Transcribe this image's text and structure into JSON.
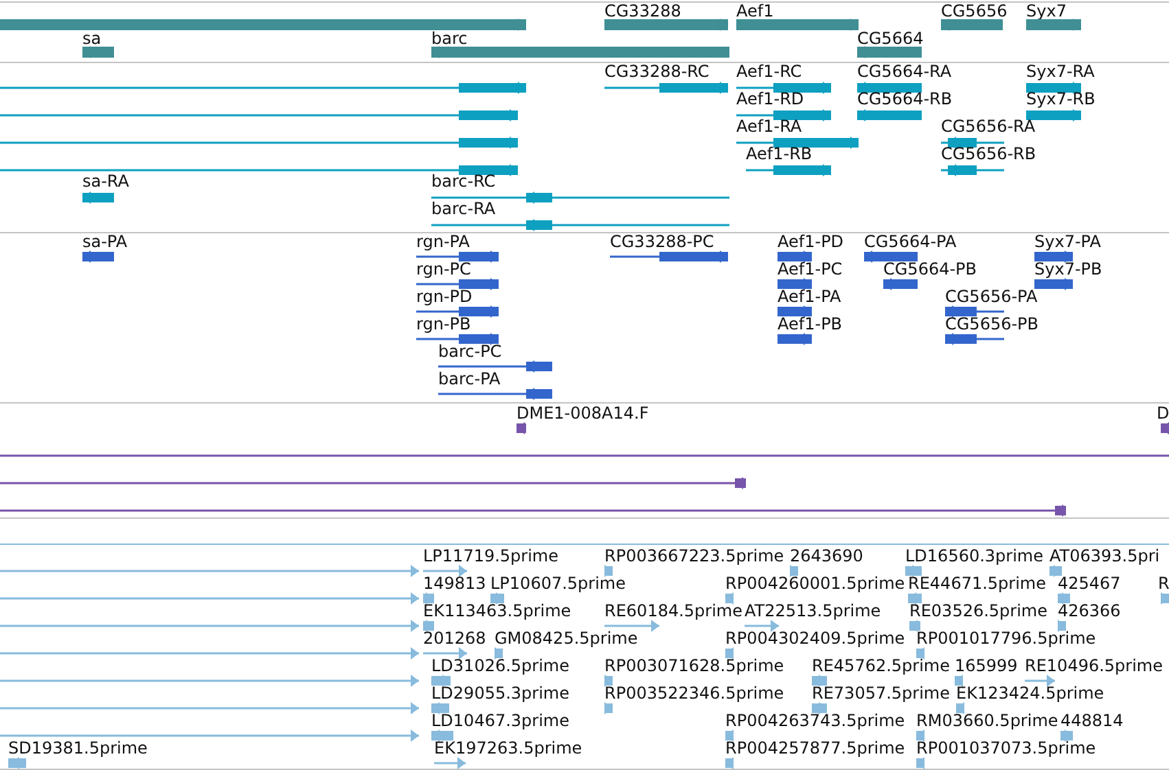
{
  "tracks": [
    {
      "kind": "gene",
      "features": [
        {
          "kind": "forward"
        },
        {
          "label": "CG33288",
          "kind": "forward"
        },
        {
          "label": "Aef1",
          "kind": "forward"
        },
        {
          "label": "CG5656",
          "kind": "reverse"
        },
        {
          "label": "Syx7",
          "kind": "forward"
        },
        {
          "label": "sa",
          "kind": "reverse"
        },
        {
          "label": "barc",
          "kind": "reverse"
        },
        {
          "label": "CG5664",
          "kind": "reverse"
        }
      ]
    },
    {
      "kind": "mrna",
      "features": [
        {
          "kind": "forward"
        },
        {
          "kind": "forward"
        },
        {
          "kind": "forward"
        },
        {
          "kind": "forward"
        },
        {
          "label": "CG33288-RC",
          "kind": "forward"
        },
        {
          "label": "Aef1-RC",
          "kind": "forward"
        },
        {
          "label": "Aef1-RD",
          "kind": "forward"
        },
        {
          "label": "Aef1-RA",
          "kind": "forward"
        },
        {
          "label": "Aef1-RB",
          "kind": "forward"
        },
        {
          "label": "CG5664-RA",
          "kind": "reverse"
        },
        {
          "label": "CG5664-RB",
          "kind": "reverse"
        },
        {
          "label": "Syx7-RA",
          "kind": "forward"
        },
        {
          "label": "Syx7-RB",
          "kind": "forward"
        },
        {
          "label": "CG5656-RA",
          "kind": "reverse"
        },
        {
          "label": "CG5656-RB",
          "kind": "reverse"
        },
        {
          "label": "sa-RA",
          "kind": "reverse"
        },
        {
          "label": "barc-RC",
          "kind": "reverse"
        },
        {
          "label": "barc-RA",
          "kind": "reverse"
        }
      ]
    },
    {
      "kind": "protein",
      "features": [
        {
          "label": "sa-PA",
          "kind": "reverse"
        },
        {
          "label": "rgn-PA",
          "kind": "forward"
        },
        {
          "label": "CG33288-PC",
          "kind": "forward"
        },
        {
          "label": "Aef1-PD",
          "kind": "forward"
        },
        {
          "label": "CG5664-PA",
          "kind": "reverse"
        },
        {
          "label": "Syx7-PA",
          "kind": "forward"
        },
        {
          "label": "rgn-PC",
          "kind": "forward"
        },
        {
          "label": "Aef1-PC",
          "kind": "forward"
        },
        {
          "label": "CG5664-PB",
          "kind": "reverse"
        },
        {
          "label": "Syx7-PB",
          "kind": "forward"
        },
        {
          "label": "rgn-PD",
          "kind": "forward"
        },
        {
          "label": "Aef1-PA",
          "kind": "forward"
        },
        {
          "label": "CG5656-PA",
          "kind": "reverse"
        },
        {
          "label": "rgn-PB",
          "kind": "forward"
        },
        {
          "label": "Aef1-PB",
          "kind": "forward"
        },
        {
          "label": "CG5656-PB",
          "kind": "reverse"
        },
        {
          "label": "barc-PC",
          "kind": "reverse"
        },
        {
          "label": "barc-PA",
          "kind": "reverse"
        }
      ]
    },
    {
      "kind": "clone",
      "features": [
        {
          "label": "DME1-008A14.F",
          "kind": "reverse"
        },
        {
          "label": "D",
          "kind": "reverse"
        },
        {
          "kind": "line"
        },
        {
          "kind": "reverse"
        },
        {
          "kind": "reverse"
        }
      ]
    },
    {
      "kind": "est",
      "features": [
        {
          "kind": "forward"
        },
        {
          "kind": "forward"
        },
        {
          "kind": "forward"
        },
        {
          "kind": "forward"
        },
        {
          "kind": "forward"
        },
        {
          "kind": "forward"
        },
        {
          "kind": "forward"
        },
        {
          "label": "LP11719.5prime",
          "kind": "forward"
        },
        {
          "label": "RP003667223.5prime",
          "kind": "forward"
        },
        {
          "label": "2643690",
          "kind": "forward"
        },
        {
          "label": "LD16560.3prime",
          "kind": "reverse"
        },
        {
          "label": "AT06393.5pri",
          "kind": "forward"
        },
        {
          "label": "149813",
          "kind": "forward"
        },
        {
          "label": "LP10607.5prime",
          "kind": "forward"
        },
        {
          "label": "RP004260001.5prime",
          "kind": "reverse"
        },
        {
          "label": "RE44671.5prime",
          "kind": "reverse"
        },
        {
          "label": "425467",
          "kind": "forward"
        },
        {
          "label": "R",
          "kind": "forward"
        },
        {
          "label": "EK113463.5prime",
          "kind": "forward"
        },
        {
          "label": "RE60184.5prime",
          "kind": "forward"
        },
        {
          "label": "AT22513.5prime",
          "kind": "forward"
        },
        {
          "label": "RE03526.5prime",
          "kind": "reverse"
        },
        {
          "label": "426366",
          "kind": "forward"
        },
        {
          "label": "201268",
          "kind": "forward"
        },
        {
          "label": "GM08425.5prime",
          "kind": "forward"
        },
        {
          "label": "RP004302409.5prime",
          "kind": "reverse"
        },
        {
          "label": "RP001017796.5prime",
          "kind": "reverse"
        },
        {
          "label": "LD31026.5prime",
          "kind": "forward"
        },
        {
          "label": "RP003071628.5prime",
          "kind": "forward"
        },
        {
          "label": "RE45762.5prime",
          "kind": "forward"
        },
        {
          "label": "165999",
          "kind": "reverse"
        },
        {
          "label": "RE10496.5prime",
          "kind": "forward"
        },
        {
          "label": "LD29055.3prime",
          "kind": "reverse"
        },
        {
          "label": "RP003522346.5prime",
          "kind": "forward"
        },
        {
          "label": "RE73057.5prime",
          "kind": "forward"
        },
        {
          "label": "EK123424.5prime",
          "kind": "reverse"
        },
        {
          "label": "LD10467.3prime",
          "kind": "reverse"
        },
        {
          "label": "RP004263743.5prime",
          "kind": "reverse"
        },
        {
          "label": "RM03660.5prime",
          "kind": "reverse"
        },
        {
          "label": "448814",
          "kind": "forward"
        },
        {
          "label": "SD19381.5prime",
          "kind": "forward"
        },
        {
          "label": "EK197263.5prime",
          "kind": "forward"
        },
        {
          "label": "RP004257877.5prime",
          "kind": "reverse"
        },
        {
          "label": "RP001037073.5prime",
          "kind": "reverse"
        }
      ]
    }
  ]
}
